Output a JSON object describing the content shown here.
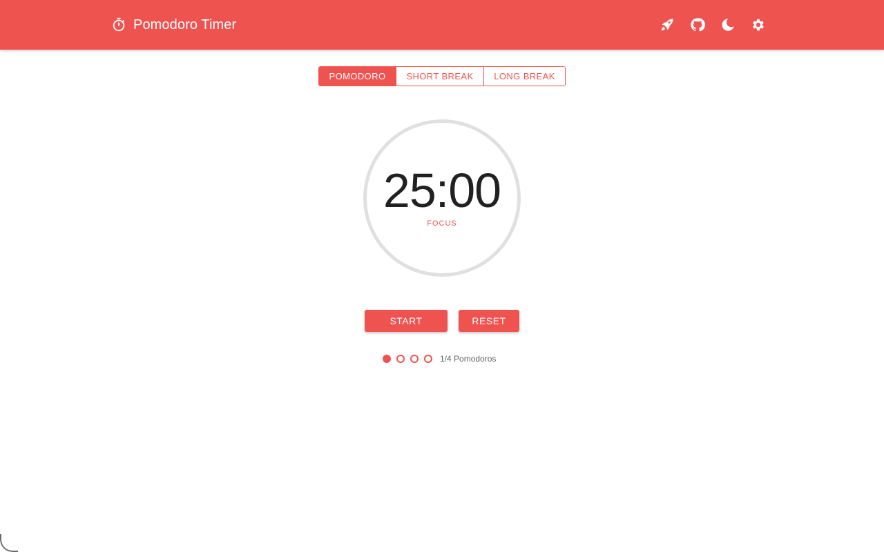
{
  "header": {
    "title": "Pomodoro Timer",
    "icons": [
      "timer-icon",
      "rocket-icon",
      "github-icon",
      "moon-icon",
      "gear-icon"
    ],
    "color": "#ef5350"
  },
  "tabs": [
    {
      "label": "POMODORO",
      "active": true
    },
    {
      "label": "SHORT BREAK",
      "active": false
    },
    {
      "label": "LONG BREAK",
      "active": false
    }
  ],
  "timer": {
    "time": "25:00",
    "label": "FOCUS"
  },
  "controls": {
    "start_label": "START",
    "reset_label": "RESET"
  },
  "progress": {
    "completed": 1,
    "total": 4,
    "text": "1/4 Pomodoros"
  },
  "colors": {
    "accent": "#ef5350",
    "ring": "#e0e0e0",
    "text": "#212121"
  }
}
